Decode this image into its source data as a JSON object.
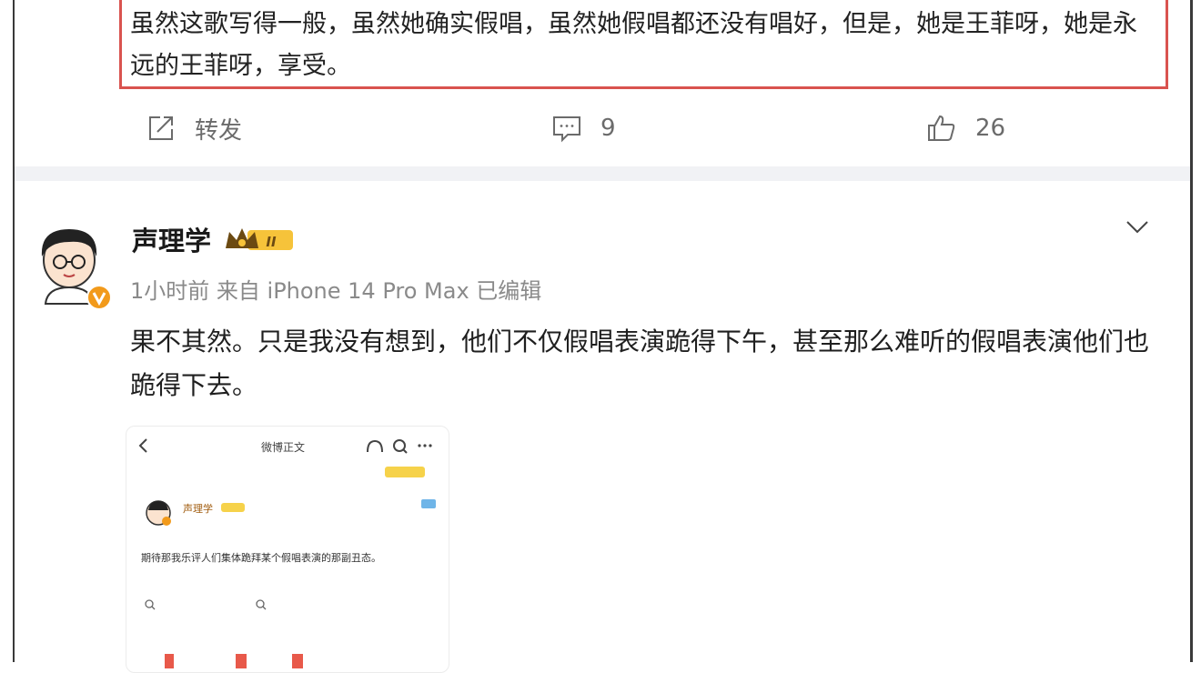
{
  "quoted_comment": {
    "text": "虽然这歌写得一般，虽然她确实假唱，虽然她假唱都还没有唱好，但是，她是王菲呀，她是永远的王菲呀，享受。"
  },
  "actions": {
    "repost_label": "转发",
    "comment_count": "9",
    "like_count": "26"
  },
  "post": {
    "username": "声理学",
    "level_badge": "II",
    "meta": "1小时前  来自 iPhone 14 Pro Max 已编辑",
    "text": "果不其然。只是我没有想到，他们不仅假唱表演跪得下午，甚至那么难听的假唱表演他们也跪得下去。"
  },
  "embedded_screenshot": {
    "nav_title": "微博正文",
    "username": "声理学",
    "body": "期待那我乐评人们集体跪拜某个假唱表演的那副丑态。"
  },
  "colors": {
    "highlight_border": "#d9534f",
    "icon_gray": "#6b6b6b",
    "verified_orange": "#f29a1b"
  },
  "icons": [
    "repost-icon",
    "comment-icon",
    "like-icon",
    "chevron-down-icon",
    "crown-badge-icon",
    "verified-icon"
  ]
}
